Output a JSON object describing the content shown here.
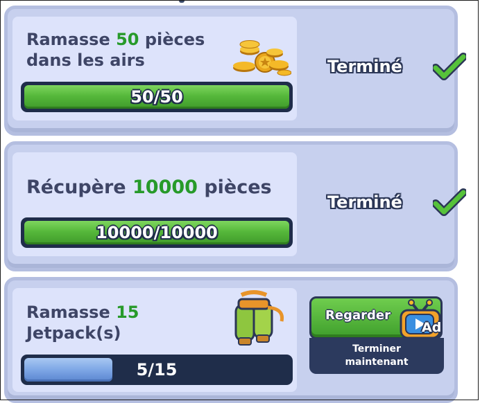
{
  "missions": [
    {
      "title_prefix": "Ramasse ",
      "title_number": "50",
      "title_suffix": " pièces",
      "title_line2": "dans les airs",
      "progress_text": "50/50",
      "progress_fraction": 1.0,
      "status": "Terminé",
      "icon": "gold-coins-icon"
    },
    {
      "title_prefix": "Récupère ",
      "title_number": "10000",
      "title_suffix": " pièces",
      "progress_text": "10000/10000",
      "progress_fraction": 1.0,
      "status": "Terminé",
      "icon": "check-icon"
    },
    {
      "title_prefix": "Ramasse ",
      "title_number": "15",
      "title_line2": "Jetpack(s)",
      "progress_text": "5/15",
      "progress_fraction": 0.333,
      "watch_label": "Regarder",
      "ad_label": "Ad",
      "finish_now_label": "Terminer maintenant",
      "icon": "jetpack-icon"
    }
  ],
  "colors": {
    "accent_green": "#279a2a",
    "card_bg": "#c7d0ee",
    "progress_blue": "#7ea7e6",
    "dark_navy": "#1f2d4a"
  }
}
